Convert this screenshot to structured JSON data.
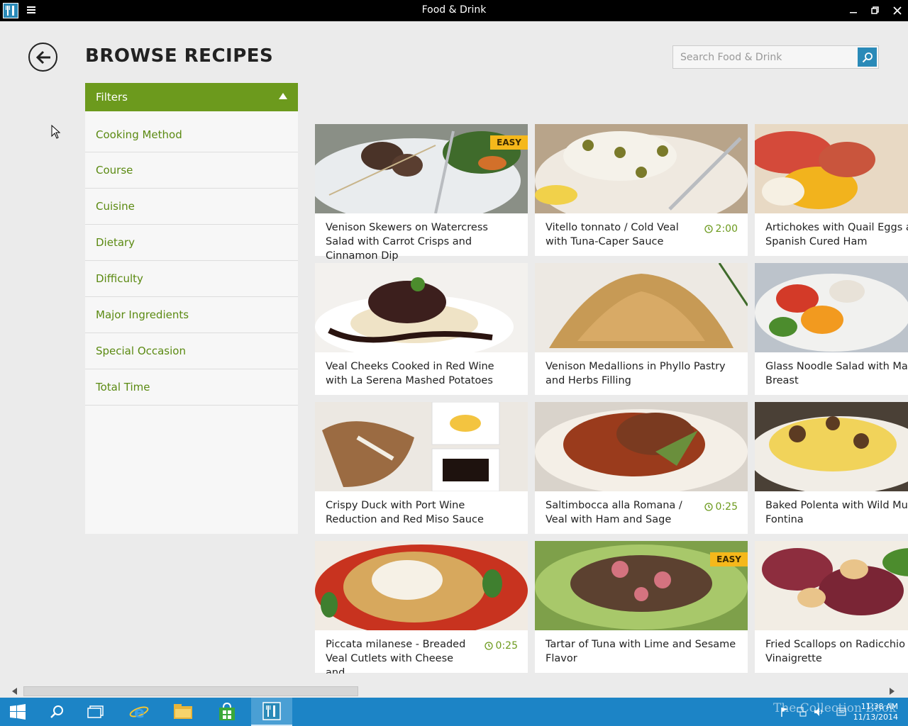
{
  "window": {
    "title": "Food & Drink",
    "icons": {
      "app": "app-fork-knife-icon",
      "menu": "hamburger-menu-icon",
      "minimize": "minimize-icon",
      "restore": "restore-icon",
      "close": "close-icon"
    }
  },
  "header": {
    "title": "BROWSE RECIPES",
    "back_icon": "back-arrow-icon",
    "search": {
      "placeholder": "Search Food & Drink",
      "value": "",
      "icon": "search-icon"
    }
  },
  "filters": {
    "title": "Filters",
    "toggle_icon": "triangle-up-icon",
    "items": [
      {
        "label": "Cooking Method"
      },
      {
        "label": "Course"
      },
      {
        "label": "Cuisine"
      },
      {
        "label": "Dietary"
      },
      {
        "label": "Difficulty"
      },
      {
        "label": "Major Ingredients"
      },
      {
        "label": "Special Occasion"
      },
      {
        "label": "Total Time"
      }
    ]
  },
  "recipes": [
    {
      "title": "Venison Skewers on Watercress Salad with Carrot Crisps and Cinnamon Dip",
      "badge": "EASY",
      "time": ""
    },
    {
      "title": "Vitello tonnato / Cold Veal with Tuna-Caper Sauce",
      "badge": "",
      "time": "2:00"
    },
    {
      "title": "Artichokes with Quail Eggs and Spanish Cured Ham",
      "badge": "",
      "time": ""
    },
    {
      "title": "Veal Cheeks Cooked in Red Wine with La Serena Mashed Potatoes",
      "badge": "",
      "time": ""
    },
    {
      "title": "Venison Medallions in Phyllo Pastry and Herbs Filling",
      "badge": "",
      "time": ""
    },
    {
      "title": "Glass Noodle Salad with Mar Chicken Breast",
      "badge": "",
      "time": ""
    },
    {
      "title": "Crispy Duck with Port Wine Reduction and Red Miso Sauce",
      "badge": "",
      "time": ""
    },
    {
      "title": "Saltimbocca alla Romana / Veal with Ham and Sage",
      "badge": "",
      "time": "0:25"
    },
    {
      "title": "Baked Polenta with Wild Mu and Fontina",
      "badge": "",
      "time": ""
    },
    {
      "title": "Piccata milanese - Breaded Veal Cutlets with Cheese and",
      "badge": "",
      "time": "0:25"
    },
    {
      "title": "Tartar of Tuna with Lime and Sesame Flavor",
      "badge": "EASY",
      "time": ""
    },
    {
      "title": "Fried Scallops on Radicchio S Parsley Vinaigrette",
      "badge": "",
      "time": ""
    }
  ],
  "taskbar": {
    "items": [
      "windows-start-icon",
      "search-icon",
      "task-view-icon",
      "internet-explorer-icon",
      "file-explorer-icon",
      "store-icon",
      "food-drink-app-icon"
    ],
    "clock_time": "11:38 AM",
    "clock_date": "11/13/2014",
    "watermark": "The Collection Book"
  },
  "colors": {
    "accent_green": "#6c9a1d",
    "brand_blue": "#2a8ab8",
    "badge_yellow": "#f5b81b",
    "taskbar_blue": "#1c84c6"
  }
}
